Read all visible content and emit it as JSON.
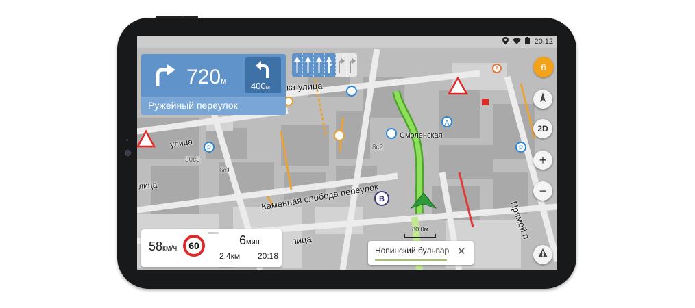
{
  "statusbar": {
    "time": "20:12"
  },
  "instruction": {
    "distance_value": "720",
    "distance_unit": "м",
    "next_distance_value": "400",
    "next_distance_unit": "м",
    "street": "Ружейный переулок"
  },
  "lanes": [
    {
      "direction": "straight",
      "active": true
    },
    {
      "direction": "straight",
      "active": true
    },
    {
      "direction": "straight",
      "active": true
    },
    {
      "direction": "straight-right",
      "active": true
    },
    {
      "direction": "right",
      "active": false
    },
    {
      "direction": "right",
      "active": false
    }
  ],
  "map_labels": {
    "street_top": "ка улица",
    "street_left_1": "улица",
    "street_left_2": "лица",
    "street_main": "Каменная слобода переулок",
    "street_bottom": "лица",
    "street_right": "Прямой п",
    "poi_smolenskaya": "Смоленская",
    "building_1": "30с3",
    "building_2": "6с1",
    "building_3": "8с2"
  },
  "controls": {
    "notification_count": "6",
    "compass": "compass",
    "view_mode": "2D",
    "zoom_in": "+",
    "zoom_out": "−"
  },
  "panel": {
    "speed_value": "58",
    "speed_unit": "км/ч",
    "speed_limit": "60",
    "duration_value": "6",
    "duration_unit": "мин",
    "remaining_distance": "2.4км",
    "arrival_time": "20:18"
  },
  "destination": {
    "name": "Новинский бульвар",
    "progress": 0.25
  },
  "scale_bar": "80.0м",
  "colors": {
    "instruction_blue": "#5f93c9",
    "instruction_dark": "#3e71a6",
    "route_green": "#6ecf3a",
    "badge_orange": "#f3a21b",
    "limit_red": "#e02a2a"
  }
}
